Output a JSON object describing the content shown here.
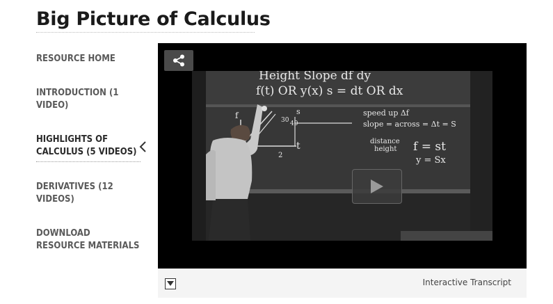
{
  "page": {
    "title": "Big Picture of Calculus"
  },
  "sidebar": {
    "items": [
      {
        "label": "RESOURCE HOME"
      },
      {
        "label": "INTRODUCTION (1 VIDEO)"
      },
      {
        "label": "HIGHLIGHTS OF CALCULUS (5 VIDEOS)"
      },
      {
        "label": "DERIVATIVES (12 VIDEOS)"
      },
      {
        "label": "DOWNLOAD RESOURCE MATERIALS"
      }
    ],
    "active_index": 2
  },
  "player": {
    "share_icon": "share-icon",
    "play_icon": "play-icon",
    "board": {
      "line1": "Height   Slope  df      dy",
      "line2": "f(t)  OR  y(x)      s = dt   OR  dx",
      "speed": "speed  up   Δf",
      "slope": "slope = across = Δt = S",
      "distance": "distance",
      "height": "height",
      "eq1": "f = st",
      "eq2": "y = Sx",
      "axis_f": "f",
      "axis_t": "t",
      "axis_s": "s",
      "num_40": "40",
      "num_30": "30",
      "num_2": "2"
    }
  },
  "toolbar": {
    "toggle_icon": "chevron-down-icon",
    "transcript_label": "Interactive Transcript"
  }
}
